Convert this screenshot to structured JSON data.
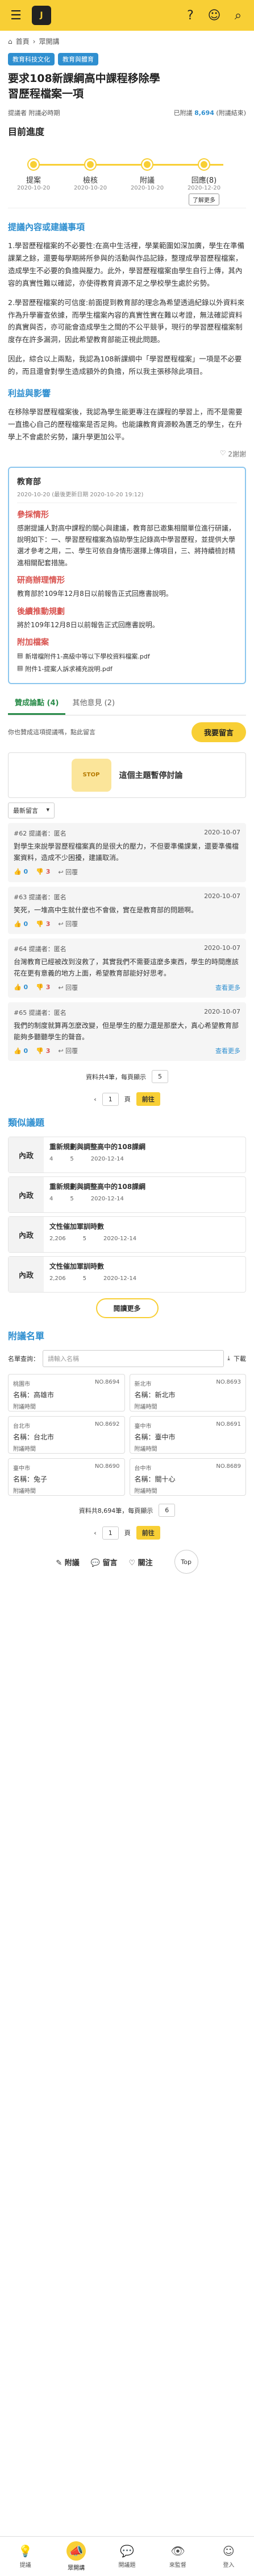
{
  "topbar": {
    "menu_icon": "hamburger-icon",
    "logo": "J",
    "help_icon": "?",
    "user_icon": "user-icon",
    "search_icon": "search-icon"
  },
  "crumb": {
    "home": "首頁",
    "sep": "›",
    "current": "眾開講"
  },
  "tags": [
    "教育科技文化",
    "教育與體育"
  ],
  "title": "要求108新課綱高中課程移除學習歷程檔案一項",
  "meta": {
    "proposer": "提議者 附議必時期",
    "sign_prefix": "已附議",
    "sign_count": "8,694",
    "sign_suffix": "(附議結束)"
  },
  "progress_title": "目前進度",
  "steps": [
    {
      "label": "提案",
      "date": "2020-10-20"
    },
    {
      "label": "檢核",
      "date": "2020-10-20"
    },
    {
      "label": "附議",
      "date": "2020-10-20"
    },
    {
      "label": "回應(8)",
      "date": "2020-12-20",
      "button": "了解更多"
    }
  ],
  "sec1": "提議內容或建議事項",
  "para1": "1.學習歷程檔案的不必要性:在高中生活裡，學業範圍如深加廣，學生在準備課業之餘，還要每學期將所參與的活動與作品記錄，整理成學習歷程檔案，造成學生不必要的負擔與壓力。此外，學習歷程檔案由學生自行上傳，其內容的真實性難以確認，亦使得教育資源不足之學校學生處於劣勢。",
  "para2": "2.學習歷程檔案的可信度:前面提到教育部的理念為希望透過紀錄以外資料來作為升學審查依據，而學生檔案內容的真實性實在難以考證，無法確認資料的真實與否，亦可能會造成學生之間的不公平競爭，現行的學習歷程檔案制度存在許多漏洞，因此希望教育部能正視此問題。",
  "para3": "因此，綜合以上兩點，我認為108新課綱中「學習歷程檔案」一項是不必要的，而且還會對學生造成額外的負擔，所以我主張移除此項目。",
  "sec2": "利益與影響",
  "para4": "在移除學習歷程檔案後，我認為學生能更專注在課程的學習上，而不是需要一直擔心自己的歷程檔案是否足夠。也能讓教育資源較為匱乏的學生，在升學上不會處於劣勢，讓升學更加公平。",
  "share": "2謝謝",
  "dept": {
    "name": "教育部",
    "date": "2020-10-20 (最後更新日期 2020-10-20 19:12)",
    "sub1": "參採情形",
    "txt1": "感謝提議人對高中課程的關心與建議，教育部已邀集相關單位進行研議，說明如下：一、學習歷程檔案為協助學生記錄高中學習歷程，並提供大學選才參考之用，二、學生可依自身情形選擇上傳項目，三、將持續檢討精進相關配套措施。",
    "sub2": "研商辦理情形",
    "txt2": "教育部於109年12月8日以前報告正式回應書說明。",
    "sub3": "後續推動規劃",
    "txt3": "將於109年12月8日以前報告正式回應書說明。",
    "sub4": "附加檔案",
    "files": [
      "新增檔附件1-高級中等以下學校資料檔案.pdf",
      "附件1-提案人訴求補充說明.pdf"
    ]
  },
  "tabs": {
    "tab1": "贊成論點 (4)",
    "tab2": "其他意見 (2)"
  },
  "cta": {
    "hint": "你也贊成這項提議嗎，點此留言",
    "button": "我要留言"
  },
  "stop": {
    "tag": "STOP",
    "text": "這個主題暫停討論"
  },
  "sort": {
    "value": "最新留言",
    "icon": "chevron-down-icon"
  },
  "comments": [
    {
      "id": "#62",
      "author": "匿名",
      "date": "2020-10-07",
      "body": "對學生來說學習歷程檔案真的是很大的壓力，不但要準備課業，還要準備檔案資料，造成不少困擾，建議取消。",
      "up": "0",
      "down": "3",
      "more": ""
    },
    {
      "id": "#63",
      "author": "匿名",
      "date": "2020-10-07",
      "body": "笑死，一堆高中生就什麼也不會做，實在是教育部的問題啊。",
      "up": "0",
      "down": "3",
      "more": ""
    },
    {
      "id": "#64",
      "author": "匿名",
      "date": "2020-10-07",
      "body": "台灣教育已經被改到沒救了，其實我們不需要這麼多東西，學生的時間應該花在更有意義的地方上面，希望教育部能好好思考。",
      "up": "0",
      "down": "3",
      "more": "查看更多"
    },
    {
      "id": "#65",
      "author": "匿名",
      "date": "2020-10-07",
      "body": "我們的制度就算再怎麼改變，但是學生的壓力還是那麼大，真心希望教育部能夠多聽聽學生的聲音。",
      "up": "0",
      "down": "3",
      "more": "查看更多"
    }
  ],
  "comment_labels": {
    "prefix": "提議者",
    "reply": "回覆",
    "reply_icon": "reply-icon"
  },
  "pager1": {
    "info": "資料共4筆，每頁顯示",
    "per": "5",
    "page": "1",
    "go": "前往",
    "total": "頁"
  },
  "activities_title": "類似議題",
  "activities": [
    {
      "kind": "內政",
      "name": "重新規劃與調整高中的108課綱",
      "a": "4",
      "b": "5",
      "date": "2020-12-14"
    },
    {
      "kind": "內政",
      "name": "重新規劃與調整高中的108課綱",
      "a": "4",
      "b": "5",
      "date": "2020-12-14"
    },
    {
      "kind": "內政",
      "name": "文性催加軍訓時數",
      "a": "2,206",
      "b": "5",
      "date": "2020-12-14"
    },
    {
      "kind": "內政",
      "name": "文性催加軍訓時數",
      "a": "2,206",
      "b": "5",
      "date": "2020-12-14"
    }
  ],
  "more_btn": "閱讀更多",
  "signers_title": "附議名單",
  "search": {
    "label": "名單查詢：",
    "placeholder": "請輸入名稱",
    "icon": "download-icon",
    "suffix": "下載"
  },
  "signers": [
    {
      "city": "桃園市",
      "no": "NO.8694",
      "name": "高雄市",
      "info": ""
    },
    {
      "city": "新北市",
      "no": "NO.8693",
      "name": "新北市",
      "info": ""
    },
    {
      "city": "台北市",
      "no": "NO.8692",
      "name": "台北市",
      "info": ""
    },
    {
      "city": "臺中市",
      "no": "NO.8691",
      "name": "臺中市",
      "info": ""
    },
    {
      "city": "臺中市",
      "no": "NO.8690",
      "name": "兔子",
      "info": ""
    },
    {
      "city": "台中市",
      "no": "NO.8689",
      "name": "關十心",
      "info": ""
    }
  ],
  "signer_labels": {
    "name": "名稱：",
    "info": "附議時間"
  },
  "pager2": {
    "info": "資料共8,694筆，每頁顯示",
    "per": "6",
    "page": "1",
    "go": "前往",
    "total": "頁"
  },
  "bottomact": {
    "b1": "附議",
    "b2": "留言",
    "b3": "關注",
    "top": "Top"
  },
  "tabbar": [
    {
      "label": "提議",
      "icon": "lightbulb-icon"
    },
    {
      "label": "眾開講",
      "icon": "megaphone-icon"
    },
    {
      "label": "開議題",
      "icon": "chat-icon"
    },
    {
      "label": "來監督",
      "icon": "eye-icon"
    },
    {
      "label": "登入",
      "icon": "user-icon"
    }
  ],
  "colors": {
    "accent": "#f8cf35",
    "blue": "#2f8fd0",
    "red": "#d9534f",
    "green": "#2a8c4a"
  }
}
